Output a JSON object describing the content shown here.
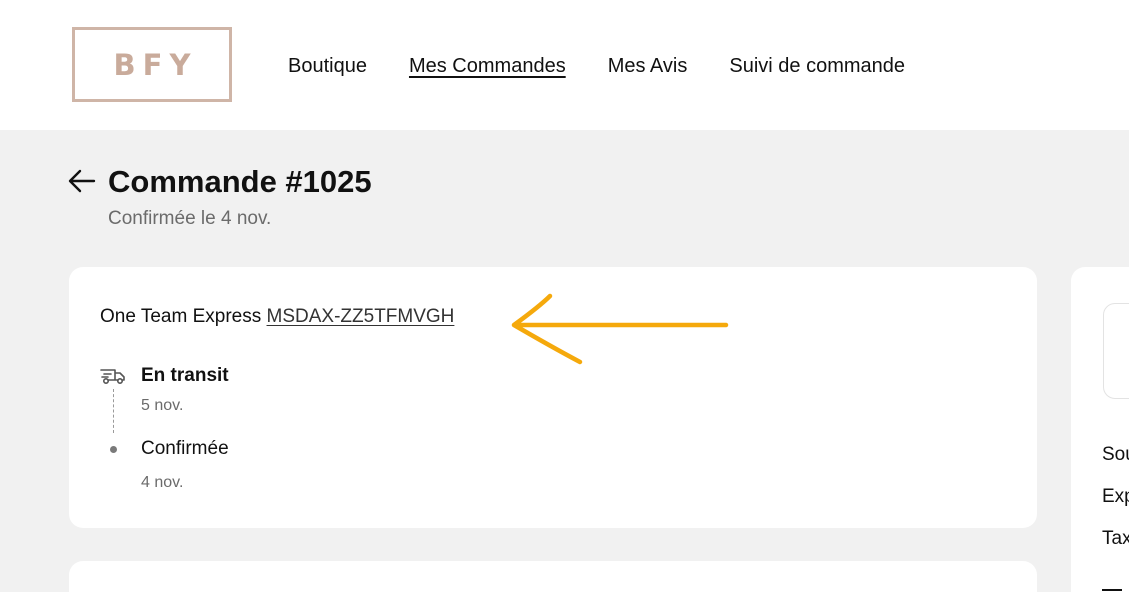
{
  "header": {
    "logo_text": "BFY",
    "nav": [
      {
        "label": "Boutique",
        "active": false
      },
      {
        "label": "Mes Commandes",
        "active": true
      },
      {
        "label": "Mes Avis",
        "active": false
      },
      {
        "label": "Suivi de commande",
        "active": false
      }
    ]
  },
  "order": {
    "title": "Commande #1025",
    "subtitle": "Confirmée le 4 nov."
  },
  "shipment": {
    "carrier": "One Team Express",
    "tracking_number": "MSDAX-ZZ5TFMVGH",
    "steps": [
      {
        "title": "En transit",
        "date": "5 nov.",
        "icon": "truck-icon"
      },
      {
        "title": "Confirmée",
        "date": "4 nov.",
        "icon": "dot"
      }
    ]
  },
  "summary": {
    "labels": [
      "Sou",
      "Exp",
      "Tax"
    ]
  },
  "colors": {
    "accent_logo": "#c9ab9b",
    "annotation_arrow": "#f5a90c",
    "background": "#f1f1f1"
  }
}
